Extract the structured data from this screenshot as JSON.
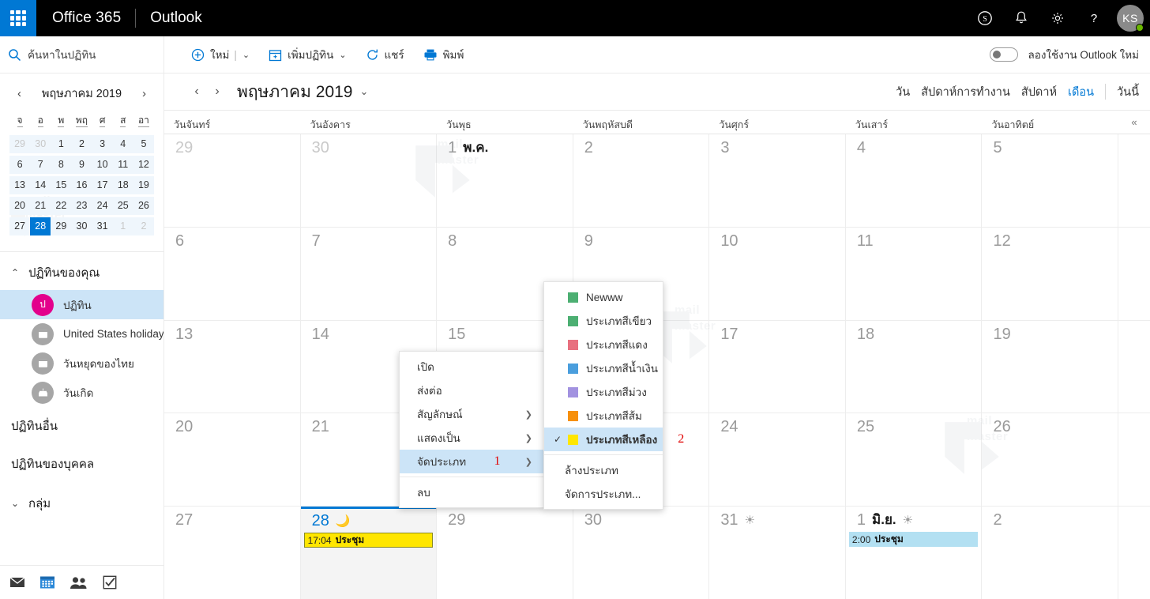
{
  "suite": {
    "brand": "Office 365",
    "app": "Outlook",
    "icons": [
      "skype-icon",
      "notifications-bell-icon",
      "settings-gear-icon",
      "help-question-icon"
    ],
    "avatar_initials": "KS"
  },
  "search": {
    "placeholder": "ค้นหาในปฏิทิน",
    "value": ""
  },
  "commandbar": {
    "new_label": "ใหม่",
    "add_calendar_label": "เพิ่มปฏิทิน",
    "share_label": "แชร์",
    "print_label": "พิมพ์",
    "toggle_label": "ลองใช้งาน Outlook ใหม่",
    "toggle_on": false
  },
  "minicalendar": {
    "title": "พฤษภาคม 2019",
    "prev": "‹",
    "next": "›",
    "dow": [
      "จ",
      "อ",
      "พ",
      "พฤ",
      "ศ",
      "ส",
      "อา"
    ],
    "weeks": [
      [
        {
          "d": "29",
          "mute": true
        },
        {
          "d": "30",
          "mute": true
        },
        {
          "d": "1"
        },
        {
          "d": "2"
        },
        {
          "d": "3"
        },
        {
          "d": "4"
        },
        {
          "d": "5"
        }
      ],
      [
        {
          "d": "6"
        },
        {
          "d": "7"
        },
        {
          "d": "8"
        },
        {
          "d": "9"
        },
        {
          "d": "10"
        },
        {
          "d": "11"
        },
        {
          "d": "12"
        }
      ],
      [
        {
          "d": "13"
        },
        {
          "d": "14"
        },
        {
          "d": "15"
        },
        {
          "d": "16"
        },
        {
          "d": "17"
        },
        {
          "d": "18"
        },
        {
          "d": "19"
        }
      ],
      [
        {
          "d": "20"
        },
        {
          "d": "21"
        },
        {
          "d": "22"
        },
        {
          "d": "23"
        },
        {
          "d": "24"
        },
        {
          "d": "25"
        },
        {
          "d": "26"
        }
      ],
      [
        {
          "d": "27"
        },
        {
          "d": "28",
          "today": true
        },
        {
          "d": "29"
        },
        {
          "d": "30"
        },
        {
          "d": "31"
        },
        {
          "d": "1",
          "mute": true
        },
        {
          "d": "2",
          "mute": true
        }
      ]
    ]
  },
  "sidebar": {
    "your_calendars_label": "ปฏิทินของคุณ",
    "calendars": [
      {
        "label": "ปฏิทิน",
        "badge": "ป",
        "badge_color": "#e3008c",
        "selected": true,
        "icon": "calendar-avatar"
      },
      {
        "label": "United States holidays",
        "badge": "",
        "badge_color": "#a6a6a6",
        "selected": false,
        "icon": "calendar-icon"
      },
      {
        "label": "วันหยุดของไทย",
        "badge": "",
        "badge_color": "#a6a6a6",
        "selected": false,
        "icon": "calendar-icon"
      },
      {
        "label": "วันเกิด",
        "badge": "",
        "badge_color": "#a6a6a6",
        "selected": false,
        "icon": "birthday-cake-icon"
      }
    ],
    "other_calendars_label": "ปฏิทินอื่น",
    "people_calendars_label": "ปฏิทินของบุคคล",
    "groups_label": "กลุ่ม",
    "modules": [
      "mail-icon",
      "calendar-icon",
      "people-icon",
      "tasks-icon"
    ]
  },
  "calendar_header": {
    "prev": "‹",
    "next": "›",
    "month_title": "พฤษภาคม 2019",
    "views": [
      {
        "label": "วัน",
        "active": false
      },
      {
        "label": "สัปดาห์การทำงาน",
        "active": false
      },
      {
        "label": "สัปดาห์",
        "active": false
      },
      {
        "label": "เดือน",
        "active": true
      }
    ],
    "today_label": "วันนี้",
    "collapse_icon": "«"
  },
  "grid": {
    "day_headers": [
      "วันจันทร์",
      "วันอังคาร",
      "วันพุธ",
      "วันพฤหัสบดี",
      "วันศุกร์",
      "วันเสาร์",
      "วันอาทิตย์"
    ],
    "weeks": [
      [
        {
          "num": "29",
          "mute": true
        },
        {
          "num": "30",
          "mute": true
        },
        {
          "num": "1",
          "month": "พ.ค."
        },
        {
          "num": "2"
        },
        {
          "num": "3"
        },
        {
          "num": "4"
        },
        {
          "num": "5"
        }
      ],
      [
        {
          "num": "6"
        },
        {
          "num": "7"
        },
        {
          "num": "8"
        },
        {
          "num": "9"
        },
        {
          "num": "10"
        },
        {
          "num": "11"
        },
        {
          "num": "12"
        }
      ],
      [
        {
          "num": "13"
        },
        {
          "num": "14"
        },
        {
          "num": "15"
        },
        {
          "num": "16"
        },
        {
          "num": "17"
        },
        {
          "num": "18"
        },
        {
          "num": "19"
        }
      ],
      [
        {
          "num": "20"
        },
        {
          "num": "21"
        },
        {
          "num": "22"
        },
        {
          "num": "23"
        },
        {
          "num": "24"
        },
        {
          "num": "25"
        },
        {
          "num": "26"
        }
      ],
      [
        {
          "num": "27"
        },
        {
          "num": "28",
          "today": true,
          "weather": "🌙",
          "events": [
            {
              "time": "17:04",
              "title": "ประชุม",
              "color": "yellow"
            }
          ]
        },
        {
          "num": "29"
        },
        {
          "num": "30"
        },
        {
          "num": "31",
          "weather": "☀"
        },
        {
          "num": "1",
          "month": "มิ.ย.",
          "weather": "☀",
          "events": [
            {
              "time": "2:00",
              "title": "ประชุม",
              "color": "blue"
            }
          ]
        },
        {
          "num": "2"
        }
      ]
    ]
  },
  "context_menu": {
    "items": [
      {
        "label": "เปิด",
        "submenu": false
      },
      {
        "label": "ส่งต่อ",
        "submenu": false
      },
      {
        "label": "สัญลักษณ์",
        "submenu": true
      },
      {
        "label": "แสดงเป็น",
        "submenu": true
      },
      {
        "label": "จัดประเภท",
        "submenu": true,
        "highlighted": true,
        "marker": "1"
      },
      {
        "label": "ลบ",
        "submenu": false
      }
    ]
  },
  "category_menu": {
    "items": [
      {
        "label": "Newww",
        "color": "#4caf72",
        "checked": false
      },
      {
        "label": "ประเภทสีเขียว",
        "color": "#4caf72",
        "checked": false
      },
      {
        "label": "ประเภทสีแดง",
        "color": "#e8707f",
        "checked": false
      },
      {
        "label": "ประเภทสีน้ำเงิน",
        "color": "#4a9edd",
        "checked": false
      },
      {
        "label": "ประเภทสีม่วง",
        "color": "#a292e0",
        "checked": false
      },
      {
        "label": "ประเภทสีส้ม",
        "color": "#f7900b",
        "checked": false
      },
      {
        "label": "ประเภทสีเหลือง",
        "color": "#ffe600",
        "checked": true,
        "highlighted": true,
        "marker": "2"
      }
    ],
    "clear_label": "ล้างประเภท",
    "manage_label": "จัดการประเภท..."
  },
  "watermark": {
    "line1": "mail",
    "line2": "master"
  }
}
